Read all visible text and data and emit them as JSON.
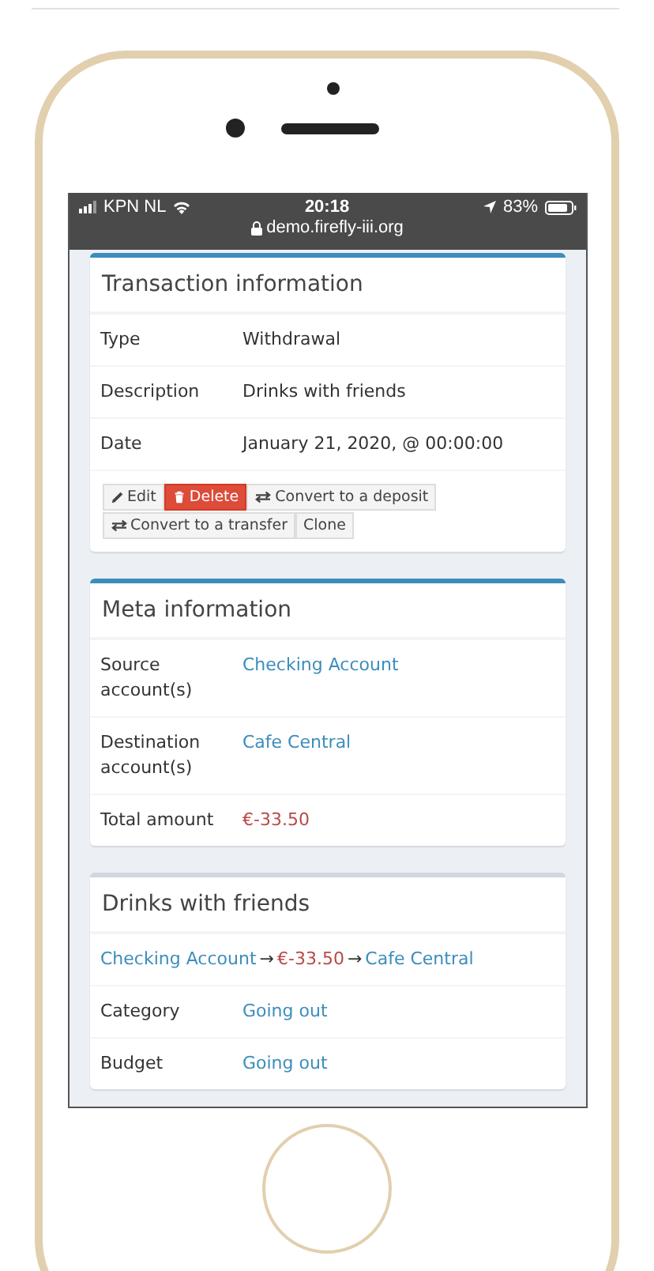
{
  "status_bar": {
    "carrier": "KPN NL",
    "time": "20:18",
    "battery": "83%",
    "url": "demo.firefly-iii.org"
  },
  "cards": [
    {
      "title": "Transaction information",
      "kind": "primary",
      "rows": [
        {
          "label": "Type",
          "value": "Withdrawal",
          "kind": "text"
        },
        {
          "label": "Description",
          "value": "Drinks with friends",
          "kind": "text"
        },
        {
          "label": "Date",
          "value": "January 21, 2020, @ 00:00:00",
          "kind": "text"
        }
      ],
      "buttons": [
        {
          "label": "Edit",
          "kind": "edit"
        },
        {
          "label": "Delete",
          "kind": "delete"
        },
        {
          "label": "Convert to a deposit",
          "kind": "convert"
        },
        {
          "label": "Convert to a transfer",
          "kind": "convert"
        },
        {
          "label": "Clone",
          "kind": "clone"
        }
      ]
    },
    {
      "title": "Meta information",
      "kind": "primary",
      "rows": [
        {
          "label": "Source account(s)",
          "value": "Checking Account",
          "kind": "link"
        },
        {
          "label": "Destination account(s)",
          "value": "Cafe Central",
          "kind": "link"
        },
        {
          "label": "Total amount",
          "value": "€-33.50",
          "kind": "amount"
        }
      ]
    },
    {
      "title": "Drinks with friends",
      "kind": "plain",
      "flow": [
        {
          "text": "Checking Account",
          "kind": "link"
        },
        {
          "text": "→",
          "kind": "arrow"
        },
        {
          "text": "€-33.50",
          "kind": "amount"
        },
        {
          "text": "→",
          "kind": "arrow"
        },
        {
          "text": "Cafe Central",
          "kind": "link"
        }
      ],
      "rows": [
        {
          "label": "Category",
          "value": "Going out",
          "kind": "link"
        },
        {
          "label": "Budget",
          "value": "Going out",
          "kind": "link"
        }
      ]
    }
  ]
}
